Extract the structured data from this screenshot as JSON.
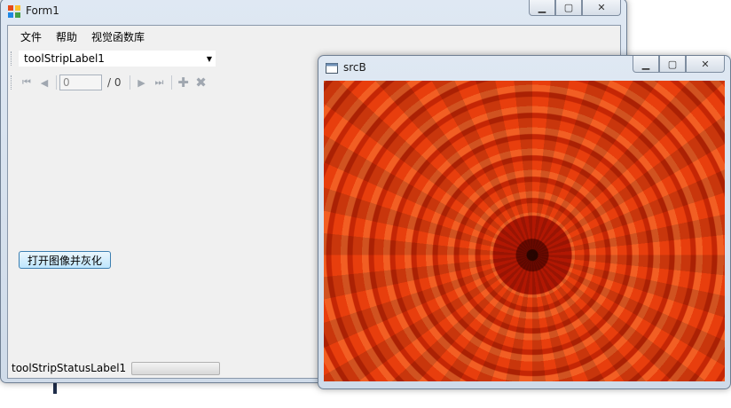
{
  "form1": {
    "title": "Form1",
    "menu": [
      "文件",
      "帮助",
      "视觉函数库"
    ],
    "toolstrip_combo_text": "toolStripLabel1",
    "navigator": {
      "position": "0",
      "count_label": "/ 0"
    },
    "open_button_label": "打开图像并灰化",
    "status_label": "toolStripStatusLabel1",
    "progress": 0
  },
  "srcB": {
    "title": "srcB",
    "image_description": "Close-up of an orange-red chrysanthemum flower"
  },
  "colors": {
    "frame": "#dfe8f3",
    "client": "#f0f0f0",
    "button_border": "#3c7fb1",
    "flower": "#d83a0a"
  }
}
